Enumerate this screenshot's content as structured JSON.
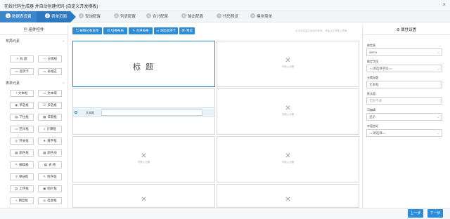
{
  "window": {
    "title": "在线代码生成器 并自动创建代码 (自定义开发模板)",
    "close_symbol": "×"
  },
  "steps": [
    {
      "num": "1",
      "label": "数据表设置"
    },
    {
      "num": "2",
      "label": "表单页面"
    },
    {
      "num": "3",
      "label": "查询配置"
    },
    {
      "num": "4",
      "label": "列表配置"
    },
    {
      "num": "5",
      "label": "合计配置"
    },
    {
      "num": "6",
      "label": "输出配置"
    },
    {
      "num": "7",
      "label": "代码预览"
    },
    {
      "num": "8",
      "label": "模块菜单"
    }
  ],
  "left": {
    "title": "▤ 组件控件",
    "layout_section": "布局元素",
    "form_section": "表单元素",
    "arrow": "⌄",
    "layout_items": [
      {
        "icon": "A",
        "label": "标 题"
      },
      {
        "icon": "—",
        "label": "分隔线"
      },
      {
        "icon": "▭",
        "label": "选项卡"
      },
      {
        "icon": "▭",
        "label": "表格区"
      }
    ],
    "form_items": [
      {
        "icon": "I",
        "label": "文本框"
      },
      {
        "icon": "▭",
        "label": "文本域"
      },
      {
        "icon": "◉",
        "label": "单选框"
      },
      {
        "icon": "☑",
        "label": "多选框"
      },
      {
        "icon": "▤",
        "label": "下拉框"
      },
      {
        "icon": "▦",
        "label": "日期框"
      },
      {
        "icon": "▭",
        "label": "区间框"
      },
      {
        "icon": "≡",
        "label": "计算框"
      },
      {
        "icon": "◎",
        "label": "开关框"
      },
      {
        "icon": "★",
        "label": "数字框"
      },
      {
        "icon": "▦",
        "label": "颜色框"
      },
      {
        "icon": "▦",
        "label": "颜色块"
      },
      {
        "icon": "✎",
        "label": "编辑器"
      },
      {
        "icon": "▦",
        "label": "表 格"
      },
      {
        "icon": "⚲",
        "label": "弹层框"
      },
      {
        "icon": "✎",
        "label": "附件框"
      },
      {
        "icon": "▤",
        "label": "上传框"
      },
      {
        "icon": "▣",
        "label": "图片框"
      },
      {
        "icon": "+",
        "label": "网型框"
      },
      {
        "icon": "◎",
        "label": "电源框"
      }
    ]
  },
  "toolbar": {
    "buttons": [
      "⇆ 按照已有表单",
      "▦ 切换布局",
      "✎ 点评表格",
      "▭ 添加选项卡",
      "👁 预览"
    ],
    "hint": "点击选择组件添加到表单，或者从左侧拖入表单"
  },
  "canvas": {
    "title_text": "标 题",
    "empty_text": "可拖入元素",
    "field_label": "文本框"
  },
  "right": {
    "title": "⚙ 属性设置",
    "props": [
      {
        "label": "绑定表",
        "value": "demo",
        "select": true
      },
      {
        "label": "绑定字段",
        "value": "==请选择字段==",
        "select": true
      },
      {
        "label": "元素标题",
        "value": "文本框",
        "select": false
      },
      {
        "label": "默认值",
        "value": "无则不填",
        "select": false
      },
      {
        "label": "可编辑",
        "value": "显示",
        "select": true
      },
      {
        "label": "字段验证",
        "value": "==请选择==",
        "select": true
      }
    ],
    "caret": "⌄"
  },
  "footer": {
    "prev": "上一步",
    "next": "下一步"
  },
  "colors": {
    "accent": "#2d8cd8",
    "step_active": "#2d79c0"
  }
}
